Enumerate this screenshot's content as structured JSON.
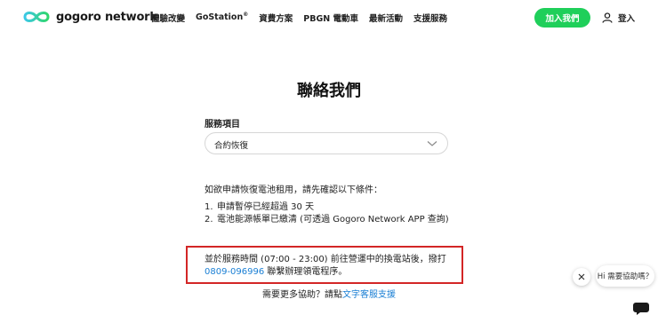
{
  "header": {
    "logo_text": "gogoro network",
    "nav": [
      {
        "label": "體驗改變"
      },
      {
        "label": "GoStation",
        "sup": "®"
      },
      {
        "label": "資費方案"
      },
      {
        "label": "PBGN 電動車"
      },
      {
        "label": "最新活動"
      },
      {
        "label": "支援服務"
      }
    ],
    "join_label": "加入我們",
    "login_label": "登入",
    "colors": {
      "accent": "#1fcf5a",
      "link": "#1a7fd4",
      "highlight_border": "#d32626"
    }
  },
  "main": {
    "title": "聯絡我們",
    "service_label": "服務項目",
    "service_value": "合約恢復",
    "intro": "如欲申請恢復電池租用，請先確認以下條件：",
    "conditions": [
      {
        "num": "1.",
        "text": "申請暫停已經超過 30 天"
      },
      {
        "num": "2.",
        "text": "電池能源帳單已繳清 (可透過 Gogoro Network APP 查詢)"
      }
    ],
    "notice_part1": "並於服務時間 (07:00 - 23:00) 前往營運中的換電站後，撥打 ",
    "notice_phone": "0809-096996",
    "notice_part2": " 聯繫辦理領電程序。",
    "help_text": "需要更多協助？請點",
    "help_link": "文字客服支援"
  },
  "chat": {
    "bubble": "Hi 需要協助嗎？",
    "close_icon": "close-icon",
    "open_icon": "chat-icon"
  }
}
